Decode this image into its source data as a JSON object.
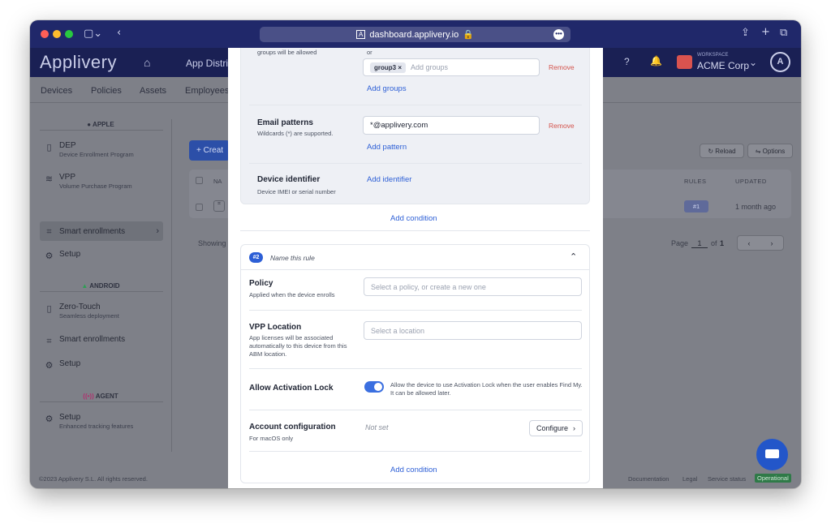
{
  "browser": {
    "url": "dashboard.applivery.io"
  },
  "app": {
    "logo": "Applivery",
    "nav_app_distribution": "App Distrib",
    "workspace_caption": "WORKSPACE",
    "workspace_name": "ACME Corp"
  },
  "subnav": [
    "Devices",
    "Policies",
    "Assets",
    "Employees"
  ],
  "sidebar": {
    "apple_header": "APPLE",
    "apple_items": [
      {
        "title": "DEP",
        "sub": "Device Enrollment Program"
      },
      {
        "title": "VPP",
        "sub": "Volume Purchase Program"
      },
      {
        "title": "Smart enrollments",
        "sub": ""
      },
      {
        "title": "Setup",
        "sub": ""
      }
    ],
    "android_header": "ANDROID",
    "android_items": [
      {
        "title": "Zero-Touch",
        "sub": "Seamless deployment"
      },
      {
        "title": "Smart enrollments",
        "sub": ""
      },
      {
        "title": "Setup",
        "sub": ""
      }
    ],
    "agent_header": "AGENT",
    "agent_items": [
      {
        "title": "Setup",
        "sub": "Enhanced tracking features"
      }
    ]
  },
  "main": {
    "create_label": "+ Creat",
    "col_name": "NA",
    "col_rules": "RULES",
    "col_updated": "UPDATED",
    "row_rules": "#1",
    "row_updated": "1 month ago",
    "showing": "Showing",
    "reload": "Reload",
    "options": "Options",
    "page_label": "Page",
    "page_num": "1",
    "page_of": "of",
    "page_total": "1"
  },
  "footer": {
    "copyright": "©2023 Applivery S.L. All rights reserved.",
    "documentation": "Documentation",
    "legal": "Legal",
    "service_status": "Service status",
    "status_badge": "Operational"
  },
  "rule1": {
    "groups_hint": "groups will be allowed",
    "or_text": "or",
    "group_tag": "group3 ×",
    "groups_placeholder": "Add groups",
    "remove": "Remove",
    "add_groups": "Add groups",
    "email_label": "Email patterns",
    "email_hint": "Wildcards (*) are supported.",
    "email_value": "*@applivery.com",
    "add_pattern": "Add pattern",
    "device_label": "Device identifier",
    "device_hint": "Device IMEI or serial number",
    "add_identifier": "Add identifier",
    "add_condition": "Add condition"
  },
  "rule2": {
    "badge": "#2",
    "name_placeholder": "Name this rule",
    "policy_label": "Policy",
    "policy_hint": "Applied when the device enrolls",
    "policy_placeholder": "Select a policy, or create a new one",
    "vpp_label": "VPP Location",
    "vpp_hint": "App licenses will be associated automatically to this device from this ABM location.",
    "vpp_placeholder": "Select a location",
    "lock_label": "Allow Activation Lock",
    "lock_desc": "Allow the device to use Activation Lock when the user enables Find My. It can be allowed later.",
    "account_label": "Account configuration",
    "account_hint": "For macOS only",
    "account_value": "Not set",
    "configure": "Configure",
    "add_condition": "Add condition"
  },
  "colors": {
    "titlebar": "#20286a",
    "accent": "#2d5fd6",
    "toggle": "#3b6fe0",
    "remove": "#d4544d",
    "status": "#2f9e54"
  }
}
